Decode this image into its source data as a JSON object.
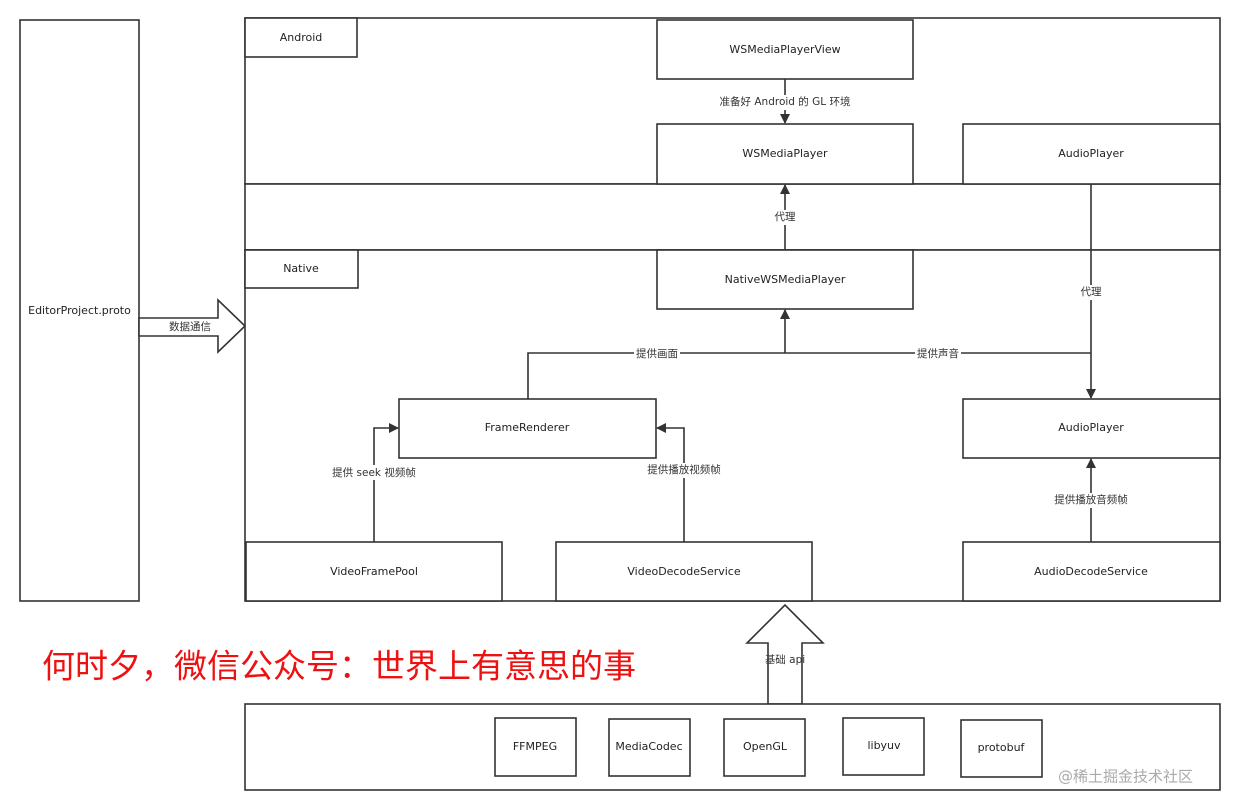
{
  "editor_project": "EditorProject.proto",
  "data_comm": "数据通信",
  "regions": {
    "android": "Android",
    "native": "Native"
  },
  "nodes": {
    "ws_media_player_view": "WSMediaPlayerView",
    "ws_media_player": "WSMediaPlayer",
    "audio_player_android": "AudioPlayer",
    "native_ws_media_player": "NativeWSMediaPlayer",
    "frame_renderer": "FrameRenderer",
    "audio_player_native": "AudioPlayer",
    "video_frame_pool": "VideoFramePool",
    "video_decode_service": "VideoDecodeService",
    "audio_decode_service": "AudioDecodeService"
  },
  "edges": {
    "gl_env": "准备好 Android 的 GL 环境",
    "proxy1": "代理",
    "proxy2": "代理",
    "provide_picture": "提供画面",
    "provide_sound": "提供声音",
    "seek_frames": "提供 seek 视频帧",
    "play_video_frames": "提供播放视频帧",
    "play_audio_frames": "提供播放音频帧",
    "base_api": "基础 api"
  },
  "libs": [
    "FFMPEG",
    "MediaCodec",
    "OpenGL",
    "libyuv",
    "protobuf"
  ],
  "banner": "何时夕，微信公众号：世界上有意思的事",
  "watermark": "@稀土掘金技术社区",
  "colors": {
    "banner": "#ee1111",
    "stroke": "#333333"
  }
}
